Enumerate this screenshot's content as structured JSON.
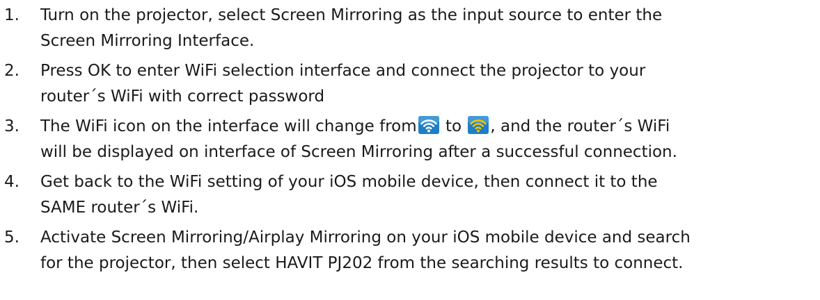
{
  "steps": [
    {
      "number": "1.",
      "lines": [
        "Turn on the projector, select Screen Mirroring as the input source to enter the",
        "Screen Mirroring Interface."
      ]
    },
    {
      "number": "2.",
      "lines": [
        "Press OK to enter WiFi selection interface and connect the projector to your",
        "router´s WiFi with correct password"
      ]
    },
    {
      "number": "3.",
      "line1_parts": [
        "The WiFi icon on the interface will change from",
        " to ",
        ", and the router´s WiFi"
      ],
      "icons": [
        "wifi-disconnected-icon",
        "wifi-connected-icon"
      ],
      "lines": [
        "will be displayed on interface of Screen Mirroring after a successful connection."
      ]
    },
    {
      "number": "4.",
      "lines": [
        "Get back to the WiFi setting of your iOS mobile device, then connect it to the",
        "SAME router´s WiFi."
      ]
    },
    {
      "number": "5.",
      "lines": [
        "Activate Screen Mirroring/Airplay Mirroring on your iOS mobile device and search",
        "for the projector, then select HAVIT PJ202 from the searching results to connect."
      ]
    }
  ],
  "colors": {
    "text": "#1a1a1a",
    "wifi_disconnected_bg": "#1f7fc4",
    "wifi_connected_bg": "#1f7fc4",
    "wifi_connected_waves": "#f2c200"
  }
}
